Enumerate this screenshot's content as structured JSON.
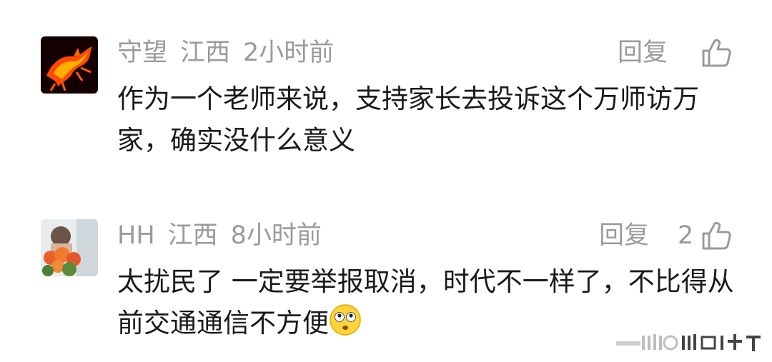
{
  "comments": [
    {
      "user": "守望",
      "location": "江西",
      "time": "2小时前",
      "reply_label": "回复",
      "likes": "",
      "text": "作为一个老师来说，支持家长去投诉这个万师访万家，确实没什么意义",
      "avatar": "fire-horse-avatar"
    },
    {
      "user": "HH",
      "location": "江西",
      "time": "8小时前",
      "reply_label": "回复",
      "likes": "2",
      "text": "太扰民了  一定要举报取消，时代不一样了，不比得从前交通通信不方便",
      "avatar": "flower-bouquet-avatar",
      "emoji": "flushed-face-emoji"
    }
  ],
  "icons": {
    "like": "thumbs-up-icon"
  },
  "colors": {
    "meta": "#9b9b9b",
    "text": "#1a1a1a"
  }
}
